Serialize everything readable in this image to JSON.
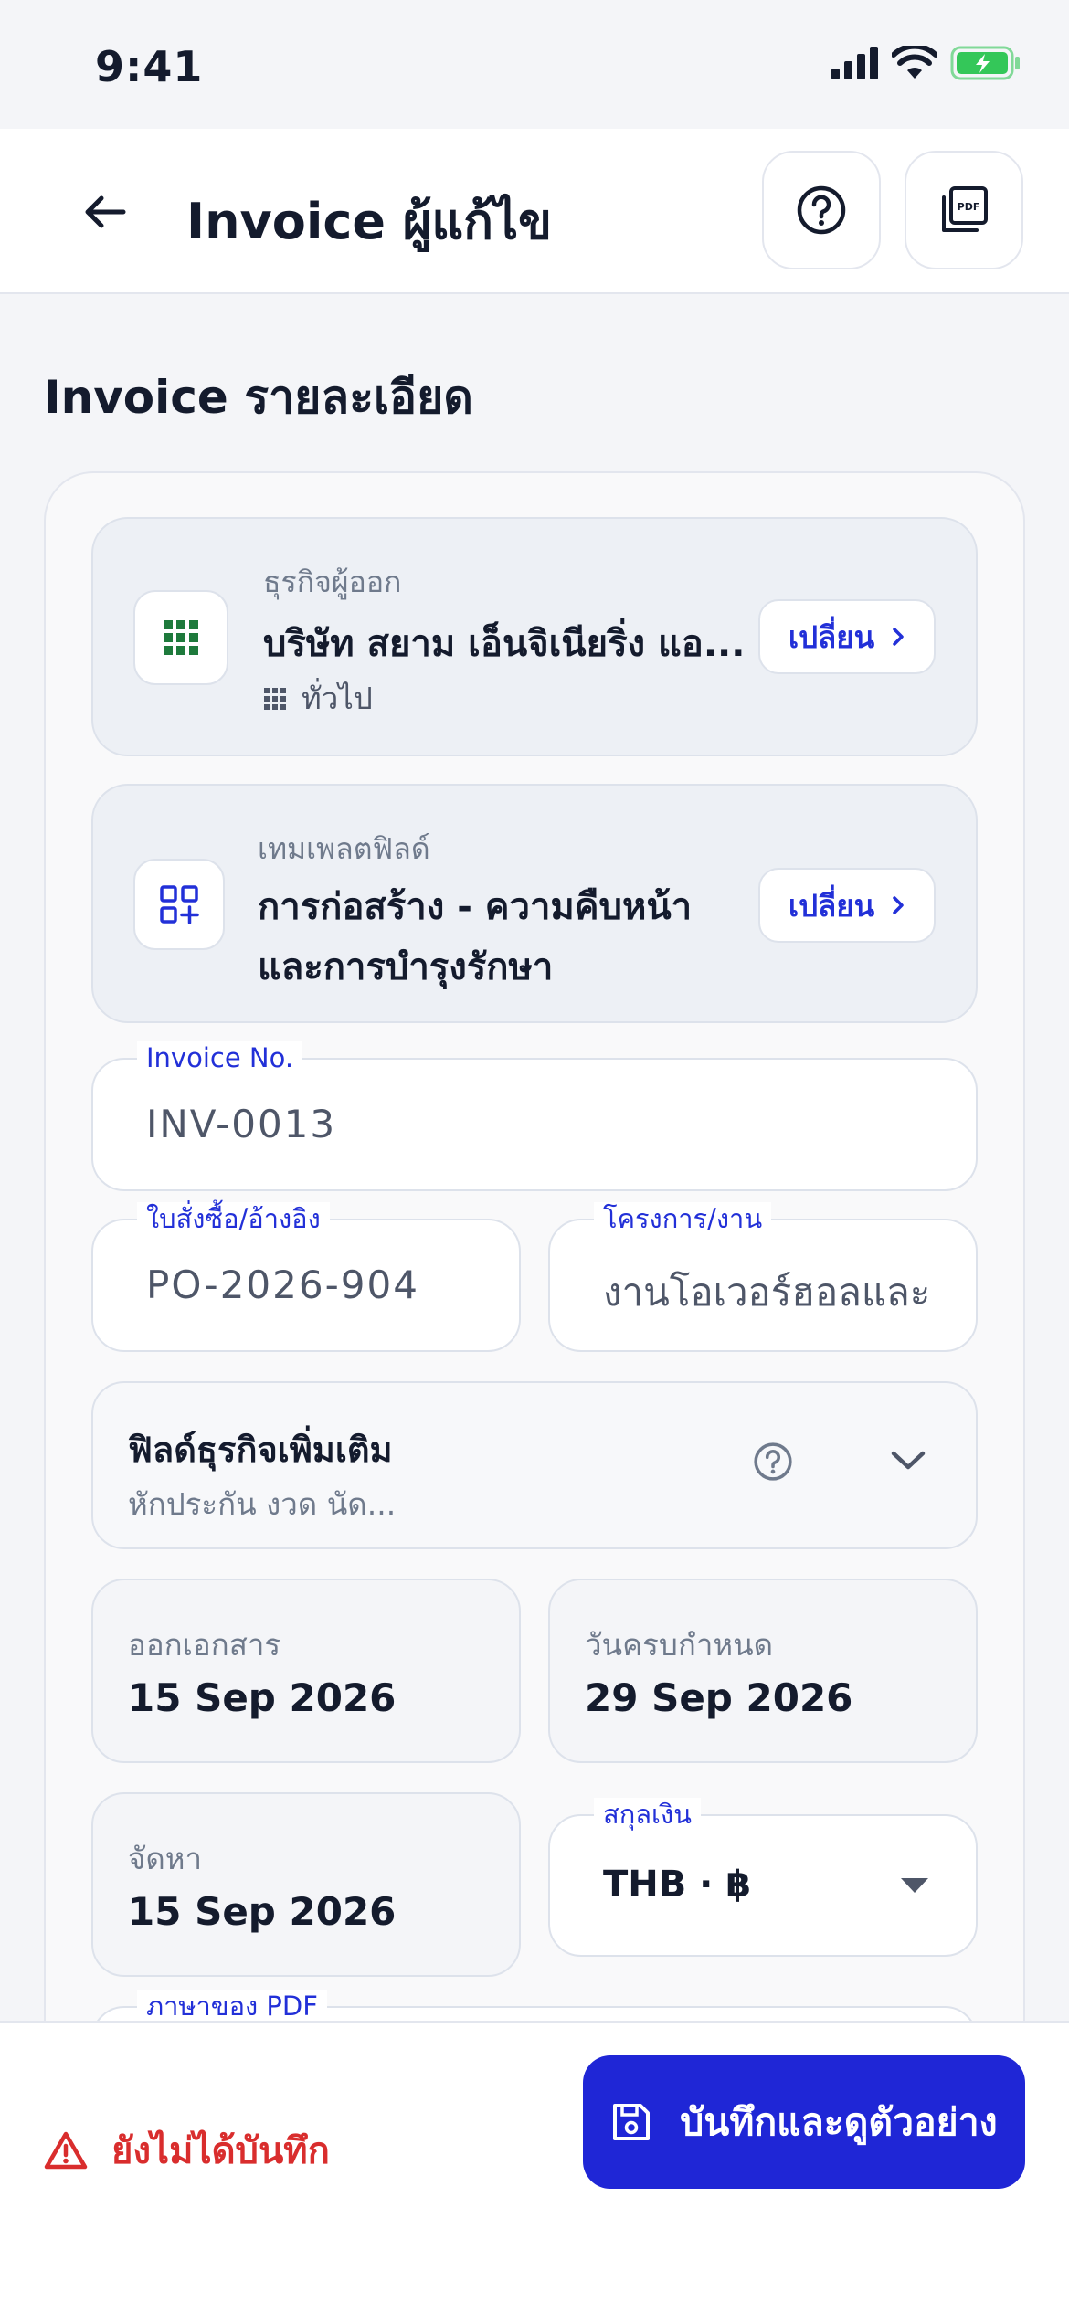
{
  "status_bar": {
    "time": "9:41"
  },
  "header": {
    "title": "Invoice ผู้แก้ไข"
  },
  "section": {
    "title": "Invoice รายละเอียด"
  },
  "business": {
    "label": "ธุรกิจผู้ออก",
    "name": "บริษัท สยาม เอ็นจิเนียริ่ง แอ...",
    "category": "ทั่วไป",
    "change_label": "เปลี่ยน"
  },
  "template": {
    "label": "เทมเพลตฟิลด์",
    "name_line1": "การก่อสร้าง - ความคืบหน้า",
    "name_line2": "และการบำรุงรักษา",
    "change_label": "เปลี่ยน"
  },
  "fields": {
    "invoice_no": {
      "label": "Invoice No.",
      "value": "INV-0013"
    },
    "po_ref": {
      "label": "ใบสั่งซื้อ/อ้างอิง",
      "value": "PO-2026-904"
    },
    "project": {
      "label": "โครงการ/งาน",
      "value": "งานโอเวอร์ฮอลและ"
    },
    "currency": {
      "label": "สกุลเงิน",
      "value": "THB · ฿"
    },
    "pdf_language": {
      "label": "ภาษาของ PDF"
    }
  },
  "extra_fields": {
    "title": "ฟิลด์ธุรกิจเพิ่มเติม",
    "subtitle": "หักประกัน งวด นัด..."
  },
  "dates": {
    "issue": {
      "label": "ออกเอกสาร",
      "value": "15 Sep 2026"
    },
    "due": {
      "label": "วันครบกำหนด",
      "value": "29 Sep 2026"
    },
    "supply": {
      "label": "จัดหา",
      "value": "15 Sep 2026"
    }
  },
  "footer": {
    "unsaved_label": "ยังไม่ได้บันทึก",
    "save_label": "บันทึกและดูตัวอย่าง"
  },
  "colors": {
    "accent": "#1f26d6",
    "link": "#2230d8",
    "warning": "#d92d2d",
    "business_icon": "#1e7a3c",
    "battery": "#34c759"
  }
}
